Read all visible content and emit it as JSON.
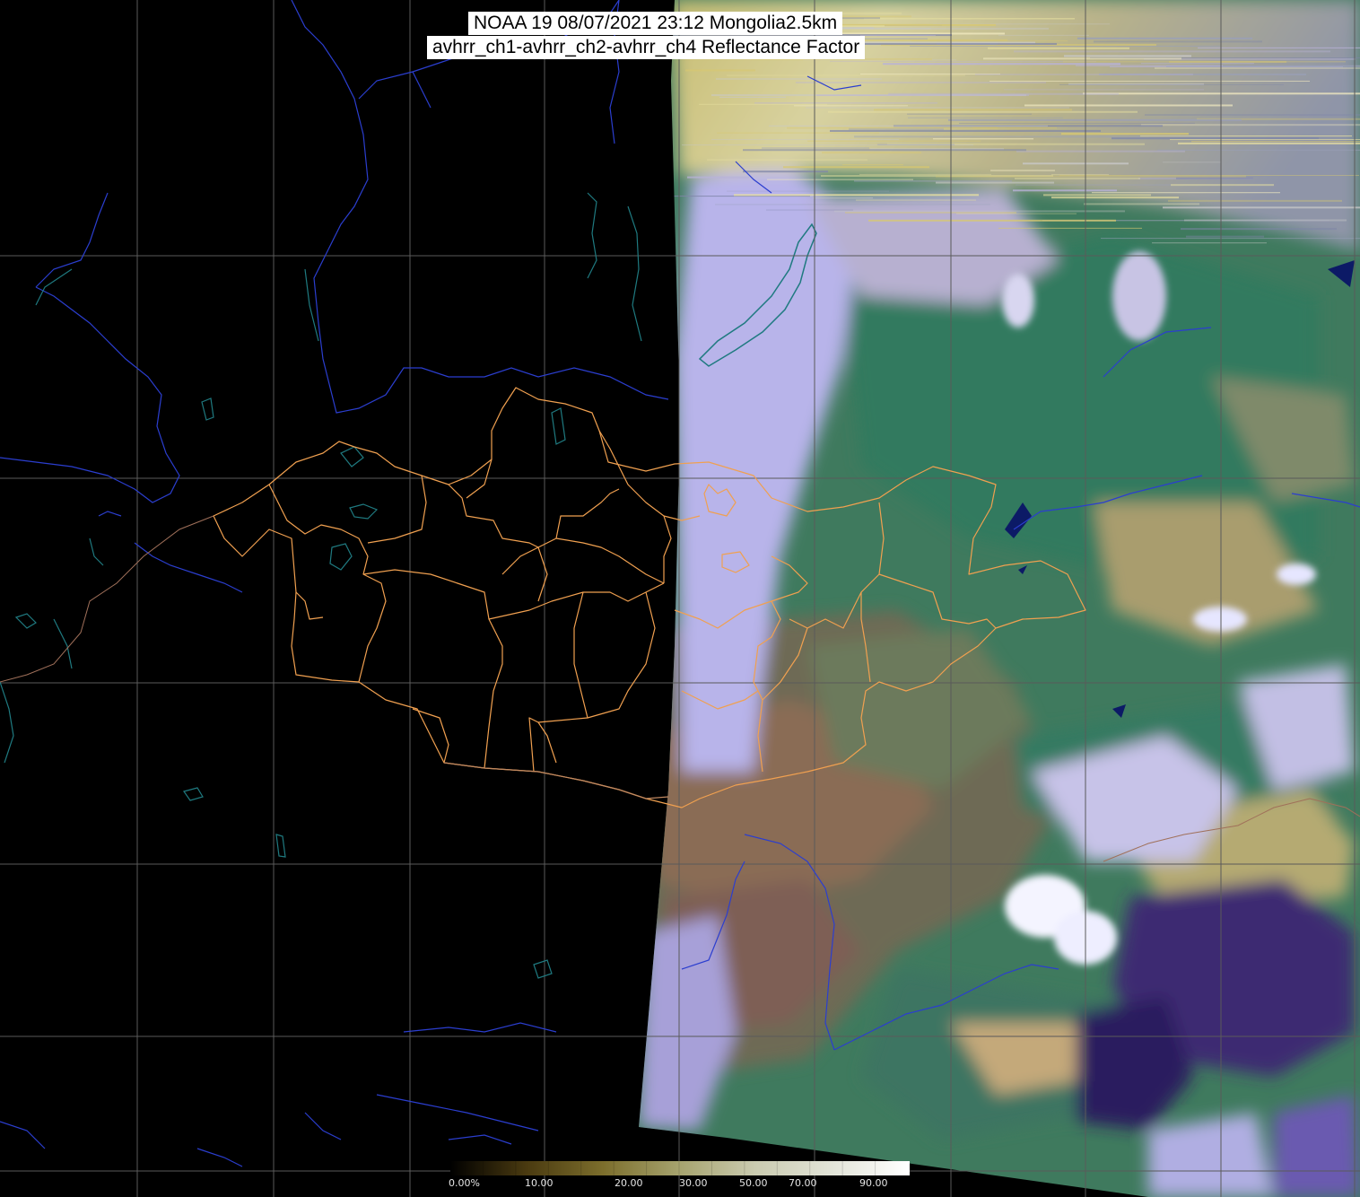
{
  "title": {
    "line1": "NOAA 19 08/07/2021 23:12 Mongolia2.5km",
    "line2": "avhrr_ch1-avhrr_ch2-avhrr_ch4 Reflectance Factor"
  },
  "colorbar": {
    "ticks": [
      "0.00%",
      "10.00",
      "20.00",
      "30.00",
      "50.00",
      "70.00",
      "90.00"
    ],
    "stops": [
      "#000000",
      "#4a3a10",
      "#7c6e2c",
      "#a6a36e",
      "#cacbb0",
      "#e2e4d8",
      "#ffffff"
    ]
  },
  "colors": {
    "background": "#000000",
    "graticule": "#555555",
    "river": "#2b3ecf",
    "lake": "#1f7a80",
    "province_border": "#f0a050",
    "forest": "#3d7a5e",
    "steppe": "#6b6c55",
    "desert": "#8a6a52",
    "cloud": "#b7b4ee",
    "noise_band": "#c9c07e"
  }
}
